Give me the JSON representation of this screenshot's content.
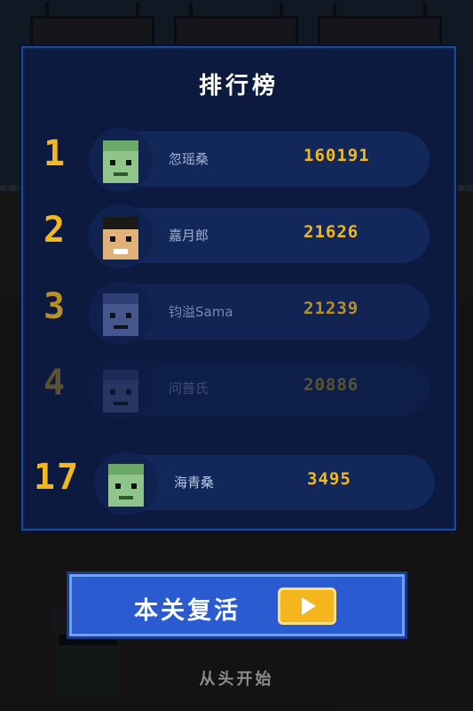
{
  "leaderboard": {
    "title": "排行榜",
    "rows": [
      {
        "rank": "1",
        "name": "忽瑶桑",
        "score": "160191",
        "avatar": "green-zombie-avatar"
      },
      {
        "rank": "2",
        "name": "嘉月郎",
        "score": "21626",
        "avatar": "human-avatar"
      },
      {
        "rank": "3",
        "name": "钧溢Sama",
        "score": "21239",
        "avatar": "blue-zombie-avatar"
      },
      {
        "rank": "4",
        "name": "问普氏",
        "score": "20886",
        "avatar": "blue-zombie-avatar"
      }
    ],
    "self": {
      "rank": "17",
      "name": "海青桑",
      "score": "3495",
      "avatar": "green-zombie-avatar"
    }
  },
  "actions": {
    "revive_label": "本关复活",
    "restart_label": "从头开始"
  },
  "colors": {
    "panel": "#0b1a3e",
    "accent": "#f2b81e",
    "button": "#2a5bd0"
  }
}
